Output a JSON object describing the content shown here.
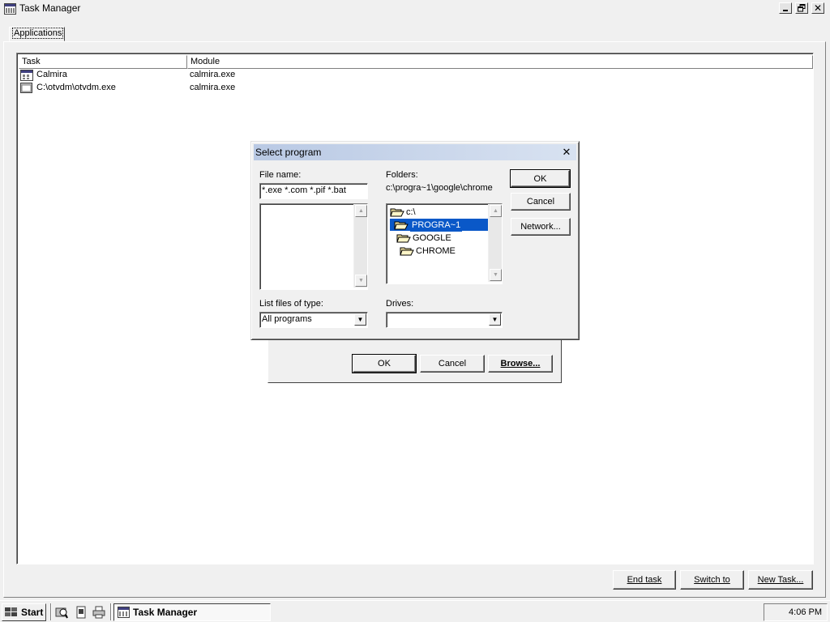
{
  "window": {
    "title": "Task Manager",
    "tab_label": "Applications"
  },
  "task_list": {
    "columns": [
      "Task",
      "Module"
    ],
    "rows": [
      {
        "task": "Calmira",
        "module": "calmira.exe",
        "icon": "calmira-app-icon"
      },
      {
        "task": "C:\\otvdm\\otvdm.exe",
        "module": "calmira.exe",
        "icon": "dos-window-icon"
      }
    ]
  },
  "buttons": {
    "end_task": "End task",
    "switch_to": "Switch to",
    "new_task": "New Task..."
  },
  "run_dialog": {
    "ok": "OK",
    "cancel": "Cancel",
    "browse": "Browse..."
  },
  "select_dialog": {
    "title": "Select program",
    "file_name_label": "File name:",
    "file_name_value": "*.exe *.com *.pif *.bat",
    "folders_label": "Folders:",
    "current_path": "c:\\progra~1\\google\\chrome",
    "folders": [
      {
        "name": "c:\\",
        "selected": false
      },
      {
        "name": "PROGRA~1",
        "selected": true
      },
      {
        "name": "GOOGLE",
        "selected": false
      },
      {
        "name": "CHROME",
        "selected": false
      }
    ],
    "file_type_label": "List files of type:",
    "file_type_value": "All programs",
    "drives_label": "Drives:",
    "drives_value": "",
    "ok": "OK",
    "cancel": "Cancel",
    "network": "Network..."
  },
  "taskbar": {
    "start_label": "Start",
    "task_button": "Task Manager",
    "clock": "4:06 PM"
  },
  "colors": {
    "selection": "#0a58c8",
    "dialog_title_gradient": [
      "#b9c9e4",
      "#d8e2f1"
    ],
    "face": "#f0f0f0"
  }
}
